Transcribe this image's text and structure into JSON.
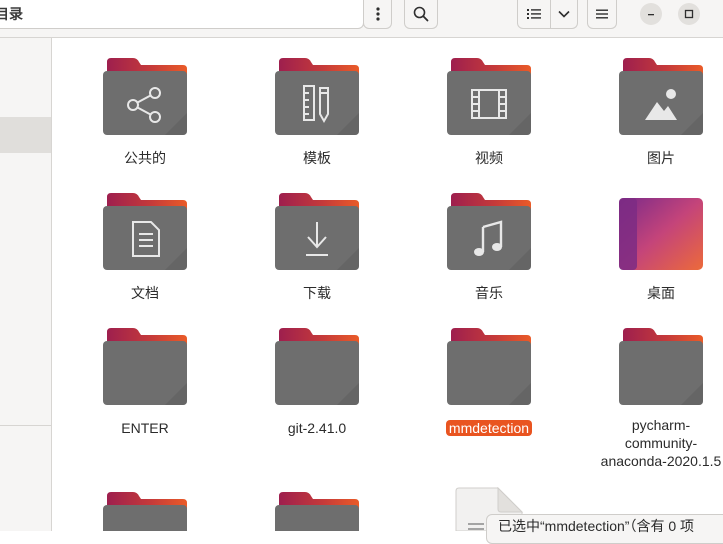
{
  "header": {
    "path_label": "目录",
    "menu_icon": "kebab-menu-icon",
    "search_icon": "search-icon",
    "view_list_icon": "list-view-icon",
    "view_dropdown_icon": "chevron-down-icon",
    "hamburger_icon": "hamburger-menu-icon",
    "minimize_icon": "minimize-icon",
    "maximize_icon": "maximize-icon"
  },
  "colors": {
    "accent": "#e95420",
    "folder_body": "#6f6f6f",
    "folder_tab_start": "#a9234b",
    "folder_tab_end": "#e6572a"
  },
  "grid": {
    "items": [
      {
        "label": "公共的",
        "icon": "share-icon"
      },
      {
        "label": "模板",
        "icon": "template-icon"
      },
      {
        "label": "视频",
        "icon": "video-icon"
      },
      {
        "label": "图片",
        "icon": "picture-icon"
      },
      {
        "label": "文档",
        "icon": "document-icon"
      },
      {
        "label": "下载",
        "icon": "download-icon"
      },
      {
        "label": "音乐",
        "icon": "music-icon"
      },
      {
        "label": "桌面",
        "icon": "desktop-folder-icon"
      },
      {
        "label": "ENTER",
        "icon": "folder-icon"
      },
      {
        "label": "git-2.41.0",
        "icon": "folder-icon"
      },
      {
        "label": "mmdetection",
        "icon": "folder-icon",
        "selected": true
      },
      {
        "label_lines": [
          "pycharm-",
          "community-",
          "anaconda-2020.1.5"
        ],
        "icon": "folder-icon"
      },
      {
        "label": "",
        "icon": "folder-icon"
      },
      {
        "label": "",
        "icon": "folder-icon"
      },
      {
        "label": "",
        "icon": "text-file-icon"
      }
    ]
  },
  "status": {
    "text": "已选中“mmdetection”（含有 0 项"
  }
}
